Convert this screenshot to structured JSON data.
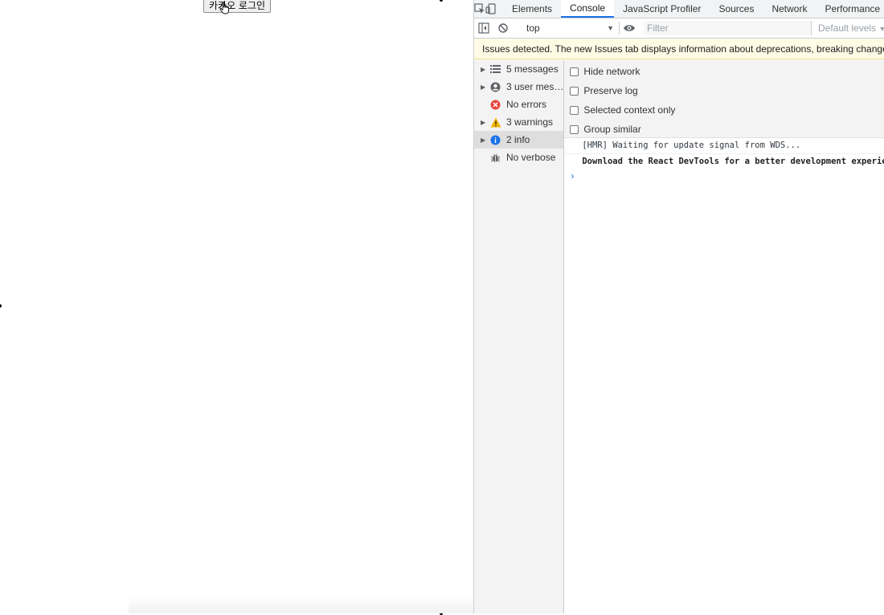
{
  "page": {
    "login_button": "카카오 로그인"
  },
  "devtools": {
    "tabs": [
      "Elements",
      "Console",
      "JavaScript Profiler",
      "Sources",
      "Network",
      "Performance"
    ],
    "active_tab": "Console",
    "toolbar": {
      "context": "top",
      "filter_placeholder": "Filter",
      "levels": "Default levels"
    },
    "banner": "Issues detected. The new Issues tab displays information about deprecations, breaking changes and other potential problems.",
    "sidebar": [
      {
        "label": "5 messages",
        "icon": "list-icon"
      },
      {
        "label": "3 user mes…",
        "icon": "user-icon"
      },
      {
        "label": "No errors",
        "icon": "error-icon"
      },
      {
        "label": "3 warnings",
        "icon": "warning-icon"
      },
      {
        "label": "2 info",
        "icon": "info-icon"
      },
      {
        "label": "No verbose",
        "icon": "bug-icon"
      }
    ],
    "options": [
      "Hide network",
      "Preserve log",
      "Selected context only",
      "Group similar"
    ],
    "logs": [
      "[HMR] Waiting for update signal from WDS...",
      "Download the React DevTools for a better development experience"
    ],
    "prompt": "›"
  }
}
